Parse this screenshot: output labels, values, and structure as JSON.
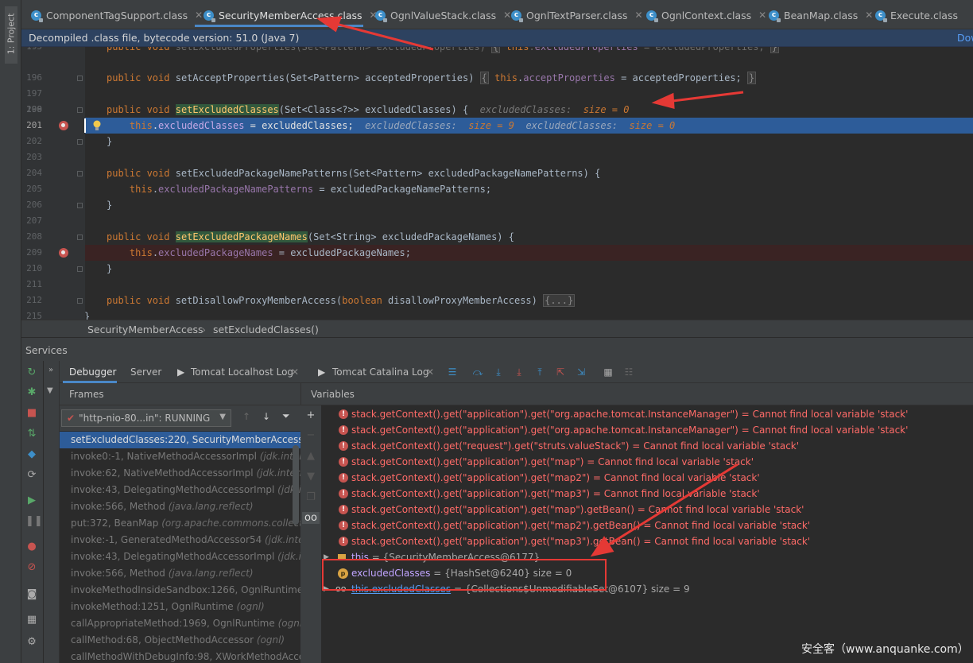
{
  "project_tab": "1: Project",
  "tabs": [
    {
      "label": "ComponentTagSupport.class"
    },
    {
      "label": "SecurityMemberAccess.class"
    },
    {
      "label": "OgnlValueStack.class"
    },
    {
      "label": "OgnlTextParser.class"
    },
    {
      "label": "OgnlContext.class"
    },
    {
      "label": "BeanMap.class"
    },
    {
      "label": "Execute.class"
    }
  ],
  "banner": {
    "text": "Decompiled .class file, bytecode version: 51.0 (Java 7)",
    "link": "Dow"
  },
  "code": {
    "line_numbers": [
      "195",
      "196",
      "199",
      "200",
      "201",
      "202",
      "203",
      "204",
      "205",
      "206",
      "207",
      "208",
      "209",
      "210",
      "211",
      "212",
      "215"
    ],
    "inlay_200": "excludedClasses:  size = 0",
    "inlay_201a": "excludedClasses:  size = 9",
    "inlay_201b": "excludedClasses:  size = 0"
  },
  "breadcrumb": {
    "class": "SecurityMemberAccess",
    "method": "setExcludedClasses()",
    "sep": "›"
  },
  "services": {
    "title": "Services"
  },
  "debug_tabs": {
    "debugger": "Debugger",
    "server": "Server",
    "localhost_log": "Tomcat Localhost Log",
    "catalina_log": "Tomcat Catalina Log"
  },
  "frames": {
    "header": "Frames",
    "thread": "\"http-nio-80...in\": RUNNING",
    "items": [
      {
        "method": "setExcludedClasses:220, SecurityMemberAccess",
        "pkg": "("
      },
      {
        "method": "invoke0:-1, NativeMethodAccessorImpl",
        "pkg": "(jdk.inter"
      },
      {
        "method": "invoke:62, NativeMethodAccessorImpl",
        "pkg": "(jdk.intern"
      },
      {
        "method": "invoke:43, DelegatingMethodAccessorImpl",
        "pkg": "(jdk.in"
      },
      {
        "method": "invoke:566, Method",
        "pkg": "(java.lang.reflect)"
      },
      {
        "method": "put:372, BeanMap",
        "pkg": "(org.apache.commons.collecti"
      },
      {
        "method": "invoke:-1, GeneratedMethodAccessor54",
        "pkg": "(jdk.inter"
      },
      {
        "method": "invoke:43, DelegatingMethodAccessorImpl",
        "pkg": "(jdk.in"
      },
      {
        "method": "invoke:566, Method",
        "pkg": "(java.lang.reflect)"
      },
      {
        "method": "invokeMethodInsideSandbox:1266, OgnlRuntime",
        "pkg": ""
      },
      {
        "method": "invokeMethod:1251, OgnlRuntime",
        "pkg": "(ognl)"
      },
      {
        "method": "callAppropriateMethod:1969, OgnlRuntime",
        "pkg": "(ognl)"
      },
      {
        "method": "callMethod:68, ObjectMethodAccessor",
        "pkg": "(ognl)"
      },
      {
        "method": "callMethodWithDebugInfo:98, XWorkMethodAcce",
        "pkg": ""
      }
    ]
  },
  "variables": {
    "header": "Variables",
    "errors": [
      {
        "expr": "stack.getContext().get(\"application\").get(\"org.apache.tomcat.InstanceManager\") =",
        "msg": "Cannot find local variable 'stack'"
      },
      {
        "expr": "stack.getContext().get(\"application\").get(\"org.apache.tomcat.InstanceManager\") =",
        "msg": "Cannot find local variable 'stack'"
      },
      {
        "expr": "stack.getContext().get(\"request\").get(\"struts.valueStack\") =",
        "msg": "Cannot find local variable 'stack'"
      },
      {
        "expr": "stack.getContext().get(\"application\").get(\"map\") =",
        "msg": "Cannot find local variable 'stack'"
      },
      {
        "expr": "stack.getContext().get(\"application\").get(\"map2\") =",
        "msg": "Cannot find local variable 'stack'"
      },
      {
        "expr": "stack.getContext().get(\"application\").get(\"map3\") =",
        "msg": "Cannot find local variable 'stack'"
      },
      {
        "expr": "stack.getContext().get(\"application\").get(\"map\").getBean() =",
        "msg": "Cannot find local variable 'stack'"
      },
      {
        "expr": "stack.getContext().get(\"application\").get(\"map2\").getBean() =",
        "msg": "Cannot find local variable 'stack'"
      },
      {
        "expr": "stack.getContext().get(\"application\").get(\"map3\").getBean() =",
        "msg": "Cannot find local variable 'stack'"
      }
    ],
    "this_row": {
      "name": "this",
      "value": "= {SecurityMemberAccess@6177}"
    },
    "param_row": {
      "name": "excludedClasses",
      "value": "= {HashSet@6240}  size = 0"
    },
    "watch_row": {
      "name": "this.excludedClasses",
      "value": "= {Collections$UnmodifiableSet@6107}  size = 9"
    }
  },
  "watermark": "安全客（www.anquanke.com）",
  "colors": {
    "accent": "#4a88c7",
    "annotation_red": "#e53935",
    "error_red": "#ff6b68",
    "keyword": "#cc7832",
    "method": "#ffc66d",
    "field": "#9876aa"
  }
}
